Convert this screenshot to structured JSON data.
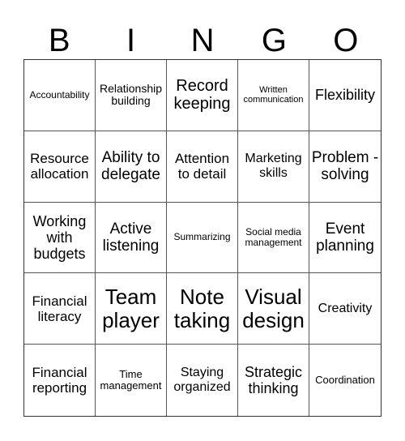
{
  "header": {
    "letters": [
      "B",
      "I",
      "N",
      "G",
      "O"
    ]
  },
  "cells": [
    "Accountability",
    "Relationship building",
    "Record keeping",
    "Written communication",
    "Flexibility",
    "Resource allocation",
    "Ability to delegate",
    "Attention to detail",
    "Marketing skills",
    "Problem -solving",
    "Working with budgets",
    "Active listening",
    "Summarizing",
    "Social media management",
    "Event planning",
    "Financial literacy",
    "Team player",
    "Note taking",
    "Visual design",
    "Creativity",
    "Financial reporting",
    "Time management",
    "Staying organized",
    "Strategic thinking",
    "Coordination"
  ]
}
